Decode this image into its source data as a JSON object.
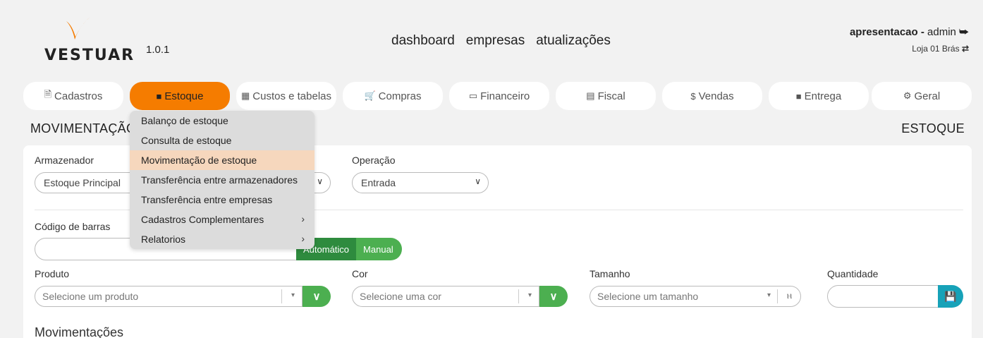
{
  "brand": {
    "name": "VESTUAR",
    "version": "1.0.1",
    "accent": "#f57c00",
    "logo_color": "#f57c00"
  },
  "topnav": {
    "items": [
      "dashboard",
      "empresas",
      "atualizações"
    ]
  },
  "user": {
    "tenant": "apresentacao -",
    "role": "admin",
    "store": "Loja 01 Brás"
  },
  "tabs": [
    {
      "label": "Cadastros",
      "icon": "file-icon"
    },
    {
      "label": "Estoque",
      "icon": "truck-icon",
      "active": true
    },
    {
      "label": "Custos e tabelas",
      "icon": "table-icon"
    },
    {
      "label": "Compras",
      "icon": "cart-icon"
    },
    {
      "label": "Financeiro",
      "icon": "credit-card-icon"
    },
    {
      "label": "Fiscal",
      "icon": "document-icon"
    },
    {
      "label": "Vendas",
      "icon": "dollar-icon"
    },
    {
      "label": "Entrega",
      "icon": "truck-icon"
    },
    {
      "label": "Geral",
      "icon": "gears-icon"
    }
  ],
  "page": {
    "breadcrumb": "MOVIMENTAÇÃO",
    "section": "ESTOQUE"
  },
  "dropdown": {
    "items": [
      {
        "label": "Balanço de estoque"
      },
      {
        "label": "Consulta de estoque"
      },
      {
        "label": "Movimentação de estoque",
        "highlighted": true
      },
      {
        "label": "Transferência entre armazenadores"
      },
      {
        "label": "Transferência entre empresas"
      },
      {
        "label": "Cadastros Complementares",
        "submenu": true
      },
      {
        "label": "Relatorios",
        "submenu": true
      }
    ]
  },
  "form": {
    "armazenador": {
      "label": "Armazenador",
      "value": "Estoque Principal"
    },
    "operacao": {
      "label": "Operação",
      "value": "Entrada"
    },
    "codigo_barras": {
      "label": "Código de barras",
      "value": ""
    },
    "mode_toggle": {
      "auto": "Automático",
      "manual": "Manual"
    },
    "produto": {
      "label": "Produto",
      "placeholder": "Selecione um produto"
    },
    "cor": {
      "label": "Cor",
      "placeholder": "Selecione uma cor"
    },
    "tamanho": {
      "label": "Tamanho",
      "placeholder": "Selecione um tamanho"
    },
    "quantidade": {
      "label": "Quantidade",
      "value": ""
    }
  },
  "movimentacoes": {
    "title": "Movimentações"
  }
}
